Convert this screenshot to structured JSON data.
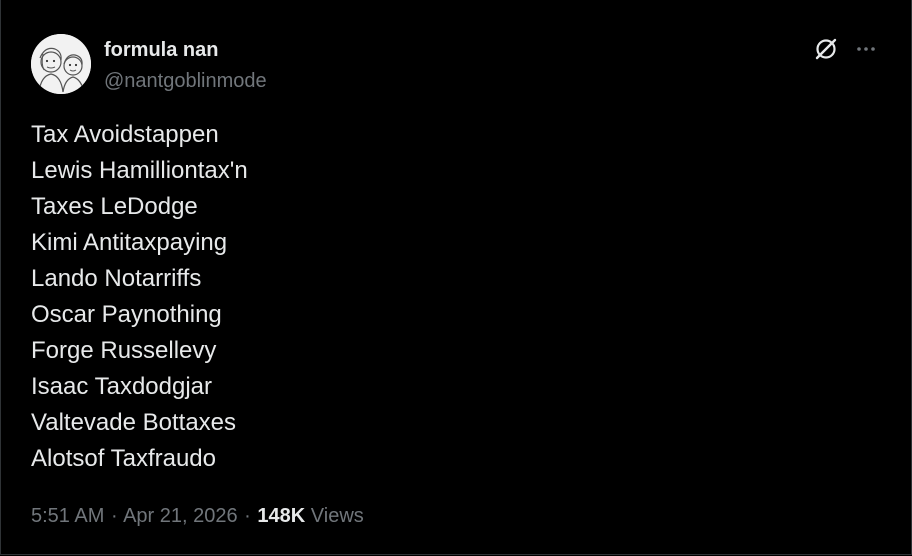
{
  "author": {
    "display_name": "formula nan",
    "handle": "@nantgoblinmode",
    "avatar_icon": "cartoon-avatar-icon"
  },
  "actions": {
    "grok_icon": "grok-icon",
    "more_icon": "more-options-icon"
  },
  "tweet": {
    "lines": [
      "Tax Avoidstappen",
      "Lewis Hamilliontax'n",
      "Taxes LeDodge",
      "Kimi Antitaxpaying",
      "Lando Notarriffs",
      "Oscar Paynothing",
      "Forge Russellevy",
      "Isaac Taxdodgjar",
      "Valtevade Bottaxes",
      "Alotsof Taxfraudo"
    ]
  },
  "meta": {
    "time": "5:51 AM",
    "separator": "·",
    "date": "Apr 21, 2026",
    "views_count": "148K",
    "views_label": "Views"
  },
  "colors": {
    "background": "#000000",
    "text_primary": "#e7e9ea",
    "text_secondary": "#71767b",
    "border": "#2f3336"
  }
}
